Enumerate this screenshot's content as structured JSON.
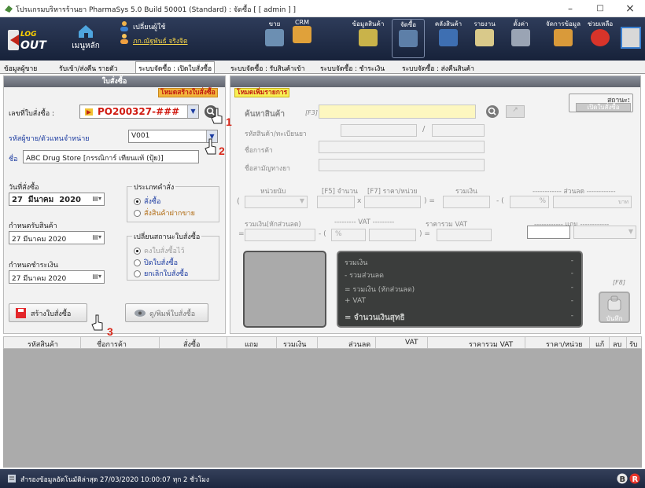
{
  "window": {
    "title": "โปรแกรมบริหารร้านยา PharmaSys 5.0 Build 50001 (Standard) : จัดซื้อ  [ [ admin ] ]",
    "minimize": "–",
    "maximize": "□",
    "close": "×"
  },
  "toolbar": {
    "logout_top": "LOG",
    "logout_bottom": "OUT",
    "home_label": "เมนูหลัก",
    "change_user_label": "เปลี่ยนผู้ใช้",
    "current_user": "ภก.ณัฐพันธ์ จริงจิต",
    "items": [
      {
        "label": "ขาย",
        "icon": "sales-icon"
      },
      {
        "label": "CRM",
        "icon": "crm-icon"
      },
      {
        "label": "ข้อมูลสินค้า",
        "icon": "product-info-icon"
      },
      {
        "label": "จัดซื้อ",
        "icon": "purchase-icon"
      },
      {
        "label": "คลังสินค้า",
        "icon": "warehouse-icon"
      },
      {
        "label": "รายงาน",
        "icon": "report-icon"
      },
      {
        "label": "ตั้งค่า",
        "icon": "settings-icon"
      },
      {
        "label": "จัดการข้อมูล",
        "icon": "data-manage-icon"
      },
      {
        "label": "ช่วยเหลือ",
        "icon": "help-icon"
      }
    ]
  },
  "tabs": [
    {
      "label": "ข้อมูลผู้ขาย",
      "active": false
    },
    {
      "label": "รับเข้า/ส่งคืน รายตัว",
      "active": false
    },
    {
      "label": "ระบบจัดซื้อ : เปิดใบสั่งซื้อ",
      "active": true
    },
    {
      "label": "ระบบจัดซื้อ : รับสินค้าเข้า",
      "active": false
    },
    {
      "label": "ระบบจัดซื้อ : ชำระเงิน",
      "active": false
    },
    {
      "label": "ระบบจัดซื้อ : ส่งคืนสินค้า",
      "active": false
    }
  ],
  "order_panel": {
    "header": "ใบสั่งซื้อ",
    "mode_badge": "โหมดสร้างใบสั่งซื้อ",
    "po_label": "เลขที่ใบสั่งซื้อ :",
    "po_number": "PO200327-###",
    "vendor_code_label": "รหัสผู้ขาย/ตัวแทนจำหน่าย",
    "vendor_code": "V001",
    "name_label": "ชื่อ",
    "vendor_name": "ABC Drug Store [กรรณิการ์ เทียนแท้ (ปุ้ย)]",
    "order_date_label": "วันที่สั่งซื้อ",
    "order_date": {
      "day": "27",
      "month": "มีนาคม",
      "year": "2020"
    },
    "order_type_group": "ประเภทคำสั่ง",
    "order_type_options": [
      "สั่งซื้อ",
      "สั่งสินค้าฝากขาย"
    ],
    "receive_date_label": "กำหนดรับสินค้า",
    "receive_date": "27  มีนาคม  2020",
    "status_group": "เปลี่ยนสถานะใบสั่งซื้อ",
    "status_options": [
      "คงใบสั่งซื้อไว้",
      "ปิดใบสั่งซื้อ",
      "ยกเลิกใบสั่งซื้อ"
    ],
    "payment_date_label": "กำหนดชำระเงิน",
    "payment_date": "27  มีนาคม  2020",
    "create_button": "สร้างใบสั่งซื้อ",
    "view_print_button": "ดู/พิมพ์ใบสั่งซื้อ"
  },
  "item_panel": {
    "mode_badge": "โหมดเพิ่มรายการ",
    "status_title": "สถานะ:",
    "status_value": "เปิดใบสั่งซื้อ",
    "search_label": "ค้นหาสินค้า",
    "search_hotkey": "[F3]",
    "product_code_label": "รหัสสินค้า/ทะเบียนยา",
    "trade_name_label": "ชื่อการค้า",
    "generic_name_label": "ชื่อสามัญทางยา",
    "unit_label": "หน่วยนับ",
    "qty_label": "[F5] จำนวน",
    "price_label": "[F7] ราคา/หน่วย",
    "total_label": "รวมเงิน",
    "discount_label": "------------ ส่วนลด ------------",
    "baht_unit": "บาท",
    "percent": "%",
    "net_label": "รวมเงิน(หักส่วนลด)",
    "vat_label": "--------- VAT ---------",
    "total_vat_label": "ราคารวม VAT",
    "free_label": "------------ แถม ------------",
    "f8_hint": "[F8]",
    "save_button": "บันทึก"
  },
  "summary": {
    "rows": [
      {
        "label": "รวมเงิน",
        "value": "-"
      },
      {
        "label": "   -  รวมส่วนลด",
        "value": "-"
      },
      {
        "label": "   =  รวมเงิน (หักส่วนลด)",
        "value": "-"
      },
      {
        "label": "   +  VAT",
        "value": "-"
      },
      {
        "label": "   =  จำนวนเงินสุทธิ",
        "value": "-"
      }
    ]
  },
  "grid": {
    "columns": [
      "รหัสสินค้า",
      "ชื่อการค้า",
      "สั่งซื้อ",
      "แถม",
      "รวมเงิน",
      "ส่วนลด",
      "VAT",
      "ราคารวม VAT",
      "ราคา/หน่วย",
      "แก้",
      "ลบ",
      "รับ"
    ]
  },
  "statusbar": {
    "text": "สำรองข้อมูลอัตโนมัติล่าสุด  27/03/2020 10:00:07   ทุก 2 ชั่วโมง"
  },
  "annotations": [
    "1",
    "2",
    "3"
  ],
  "colors": {
    "toolbar": "#1f2a44",
    "badge_orange": "#f2b43c",
    "badge_yellow": "#f7ef54",
    "accent_red": "#d8281a"
  }
}
